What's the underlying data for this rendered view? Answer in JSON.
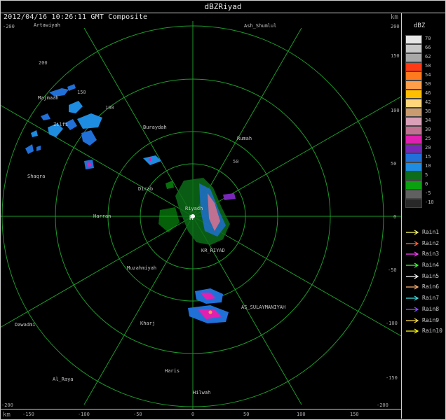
{
  "window": {
    "title": "dBZRiyad"
  },
  "header": {
    "datestamp": "2012/04/16 10:26:11 GMT Composite",
    "km_top": "km",
    "km_bottom": "km"
  },
  "legend": {
    "title": "dBZ",
    "scale": [
      {
        "label": "70",
        "color": "#e6e6e6"
      },
      {
        "label": "66",
        "color": "#c8c8c8"
      },
      {
        "label": "62",
        "color": "#a8a8a8"
      },
      {
        "label": "58",
        "color": "#ff3a14"
      },
      {
        "label": "54",
        "color": "#ff7a1e"
      },
      {
        "label": "50",
        "color": "#ff9f4a"
      },
      {
        "label": "46",
        "color": "#ffbe00"
      },
      {
        "label": "42",
        "color": "#ffd77a"
      },
      {
        "label": "38",
        "color": "#c99b6e"
      },
      {
        "label": "34",
        "color": "#d9a0b8"
      },
      {
        "label": "30",
        "color": "#c07090"
      },
      {
        "label": "25",
        "color": "#e020b0"
      },
      {
        "label": "20",
        "color": "#7828b8"
      },
      {
        "label": "15",
        "color": "#2070d8"
      },
      {
        "label": "10",
        "color": "#1e8ce0"
      },
      {
        "label": "5",
        "color": "#0c6c18"
      },
      {
        "label": "0",
        "color": "#0aa010"
      },
      {
        "label": "-5",
        "color": "#606060"
      },
      {
        "label": "-10",
        "color": "#282828"
      }
    ],
    "rain_tracks": [
      {
        "label": "Rain1",
        "color": "#ffff66"
      },
      {
        "label": "Rain2",
        "color": "#ff6a3c"
      },
      {
        "label": "Rain3",
        "color": "#ff40ff"
      },
      {
        "label": "Rain4",
        "color": "#40ff40"
      },
      {
        "label": "Rain5",
        "color": "#ffffff"
      },
      {
        "label": "Rain6",
        "color": "#ffb070"
      },
      {
        "label": "Rain7",
        "color": "#40e0e0"
      },
      {
        "label": "Rain8",
        "color": "#9050ff"
      },
      {
        "label": "Rain9",
        "color": "#ffe040"
      },
      {
        "label": "Rain10",
        "color": "#ffff00"
      }
    ]
  },
  "map": {
    "grid_color": "#1e9a2a",
    "places": [
      "Artawiyah",
      "Ash_Shumlul",
      "Majmaah",
      "Zilfi",
      "Shaqra",
      "Buraydah",
      "Rumah",
      "Riyadh",
      "Dirab",
      "Harran",
      "Muzahmiyah",
      "KR_RIYAD",
      "Kharj",
      "Dawadmi",
      "Haris",
      "Hilwah",
      "Al_Raya",
      "AS_SULAYMANIYAH"
    ],
    "ring_labels": [
      "50",
      "100",
      "150",
      "200"
    ],
    "right_axis": [
      "200",
      "150",
      "100",
      "50",
      "0",
      "-50",
      "-100",
      "-150",
      "-200"
    ],
    "left_axis": [
      "-200"
    ],
    "bottom_axis": [
      "-150",
      "-100",
      "-50",
      "0",
      "50",
      "100",
      "150"
    ]
  }
}
